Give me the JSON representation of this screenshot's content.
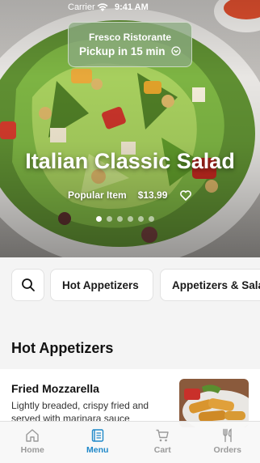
{
  "status_bar": {
    "carrier": "Carrier",
    "time": "9:41 AM"
  },
  "pickup": {
    "restaurant": "Fresco Ristorante",
    "eta": "Pickup in 15 min"
  },
  "hero": {
    "title": "Italian Classic Salad",
    "tag": "Popular Item",
    "price": "$13.99",
    "carousel": {
      "count": 6,
      "active_index": 0
    }
  },
  "categories": {
    "search_icon": "search-icon",
    "items": [
      "Hot Appetizers",
      "Appetizers & Salads"
    ]
  },
  "section": {
    "title": "Hot Appetizers",
    "items": [
      {
        "name": "Fried Mozzarella",
        "description": "Lightly breaded, crispy fried and served with marinara sauce"
      }
    ]
  },
  "tabbar": {
    "tabs": [
      {
        "label": "Home",
        "icon": "home-icon"
      },
      {
        "label": "Menu",
        "icon": "menu-icon",
        "active": true
      },
      {
        "label": "Cart",
        "icon": "cart-icon"
      },
      {
        "label": "Orders",
        "icon": "orders-icon"
      }
    ]
  },
  "colors": {
    "accent": "#1e88c9",
    "inactive": "#9a9a9a",
    "pickup_bg": "#8caa82"
  }
}
